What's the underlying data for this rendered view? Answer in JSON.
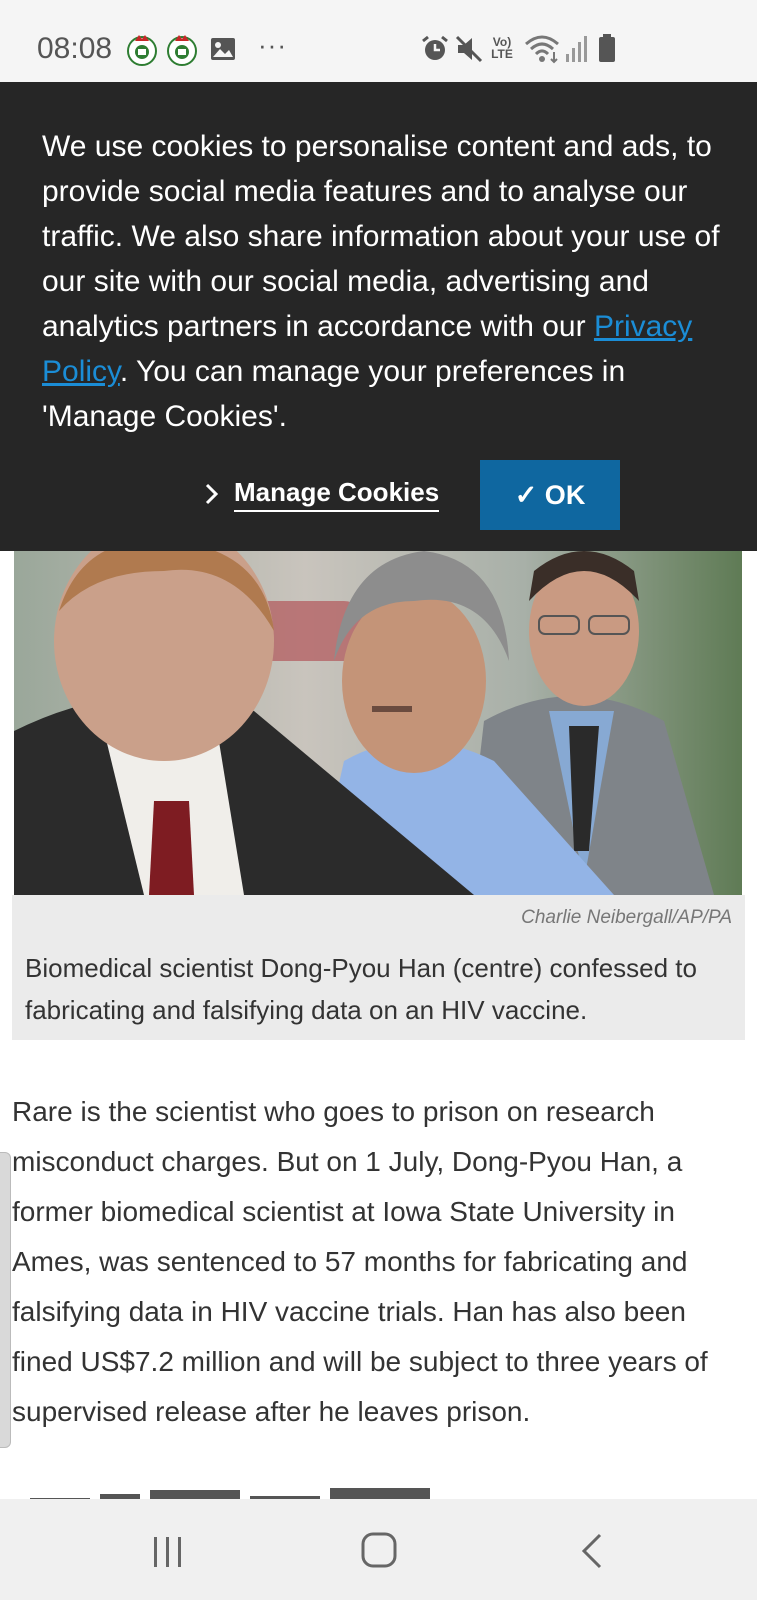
{
  "status_bar": {
    "time": "08:08",
    "icons": [
      "notification-badge-icon",
      "notification-badge-icon",
      "gallery-icon",
      "more-dots-icon",
      "alarm-icon",
      "mute-icon",
      "volte-icon",
      "wifi-icon",
      "signal-icon",
      "battery-icon"
    ],
    "volte_top": "Vo)",
    "volte_bottom": "LTE",
    "more": "···"
  },
  "cookie_banner": {
    "text_before_link": "We use cookies to personalise content and ads, to provide social media features and to analyse our traffic. We also share information about your use of our site with our social media, advertising and analytics partners in accordance with our ",
    "privacy_link": "Privacy Policy",
    "text_after_link": ". You can manage your preferences in 'Manage Cookies'.",
    "manage_label": "Manage Cookies",
    "ok_label": "✓ OK",
    "ok_color": "#0f67a0"
  },
  "figure": {
    "credit": "Charlie Neibergall/AP/PA",
    "caption": "Biomedical scientist Dong-Pyou Han (centre) confessed to fabricating and falsifying data on an HIV vaccine."
  },
  "article": {
    "paragraph": "Rare is the scientist who goes to prison on research misconduct charges. But on 1 July, Dong-Pyou Han, a former biomedical scientist at Iowa State University in Ames, was sentenced to 57 months for fabricating and falsifying data in HIV vaccine trials. Han has also been fined US$7.2 million and will be subject to three years of supervised release after he leaves prison."
  },
  "nav_bar": {
    "buttons": [
      "recent-apps-icon",
      "home-icon",
      "back-icon"
    ]
  }
}
